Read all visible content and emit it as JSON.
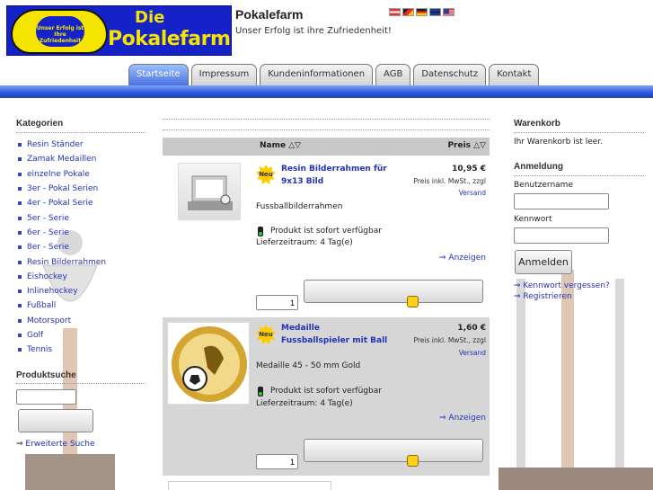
{
  "header": {
    "logo_word1": "Die",
    "logo_word2": "Pokalefarm",
    "logo_cup_text": "Unser Erfolg ist Ihre Zufriedenheit",
    "site_title": "Pokalefarm",
    "slogan": "Unser Erfolg ist ihre Zufriedenheit!",
    "flags": [
      "AT",
      "DE-special",
      "DE",
      "GB",
      "US"
    ]
  },
  "nav": {
    "tabs": [
      "Startseite",
      "Impressum",
      "Kundeninformationen",
      "AGB",
      "Datenschutz",
      "Kontakt"
    ],
    "active": "Startseite"
  },
  "sidebar_left": {
    "categories_title": "Kategorien",
    "categories": [
      "Resin Ständer",
      "Zamak Medaillen",
      "einzelne Pokale",
      "3er - Pokal Serien",
      "4er - Pokal Serie",
      "5er - Serie",
      "6er - Serie",
      "8er - Serie",
      "Resin Bilderrahmen",
      "Eishockey",
      "Inlinehockey",
      "Fußball",
      "Motorsport",
      "Golf",
      "Tennis"
    ],
    "search_title": "Produktsuche",
    "search_value": "",
    "advanced_search": "Erweiterte Suche"
  },
  "table": {
    "col_name": "Name △▽",
    "col_price": "Preis △▽"
  },
  "products": [
    {
      "badge": "Neu",
      "title": "Resin Bilderrahmen für 9x13 Bild",
      "price": "10,95 €",
      "tax": "Preis inkl. MwSt., zzgl",
      "shipping": "Versand",
      "description": "Fussballbilderrahmen",
      "availability": "Produkt ist sofort verfügbar",
      "delivery": "Lieferzeitraum: 4 Tag(e)",
      "more": "⇒ Anzeigen",
      "qty": "1"
    },
    {
      "badge": "Neu",
      "title": "Medaille Fussballspieler mit Ball",
      "price": "1,60 €",
      "tax": "Preis inkl. MwSt., zzgl",
      "shipping": "Versand",
      "description": "Medaille 45 - 50 mm Gold",
      "availability": "Produkt ist sofort verfügbar",
      "delivery": "Lieferzeitraum: 4 Tag(e)",
      "more": "⇒ Anzeigen",
      "qty": "1"
    }
  ],
  "sidebar_right": {
    "cart_title": "Warenkorb",
    "cart_empty": "Ihr Warenkorb ist leer.",
    "login_title": "Anmeldung",
    "username_label": "Benutzername",
    "password_label": "Kennwort",
    "login_button": "Anmelden",
    "forgot": "⇒ Kennwort vergessen?",
    "register": "⇒ Registrieren"
  },
  "colors": {
    "accent": "#4a70e0",
    "link": "#2233bb",
    "logo_bg": "#1522c8",
    "logo_fg": "#f5e400"
  }
}
